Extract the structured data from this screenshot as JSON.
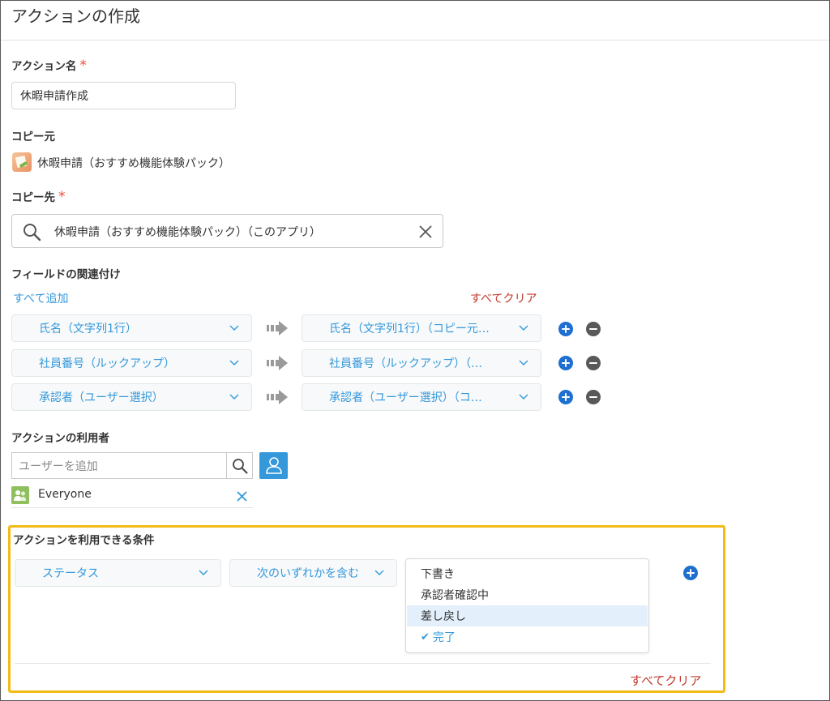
{
  "page": {
    "title": "アクションの作成"
  },
  "action_name": {
    "label": "アクション名",
    "required_mark": "*",
    "value": "休暇申請作成"
  },
  "copy_source": {
    "label": "コピー元",
    "app_name": "休暇申請（おすすめ機能体験パック）"
  },
  "copy_dest": {
    "label": "コピー先",
    "required_mark": "*",
    "value": "休暇申請（おすすめ機能体験パック）（このアプリ）"
  },
  "field_mapping": {
    "label": "フィールドの関連付け",
    "add_all": "すべて追加",
    "clear_all": "すべてクリア",
    "rows": [
      {
        "source": "氏名（文字列1行）",
        "target": "氏名（文字列1行）（コピー元…"
      },
      {
        "source": "社員番号（ルックアップ）",
        "target": "社員番号（ルックアップ）（…"
      },
      {
        "source": "承認者（ユーザー選択）",
        "target": "承認者（ユーザー選択）（コ…"
      }
    ]
  },
  "users": {
    "label": "アクションの利用者",
    "placeholder": "ユーザーを追加",
    "entries": [
      {
        "name": "Everyone"
      }
    ]
  },
  "conditions": {
    "label": "アクションを利用できる条件",
    "field_select": "ステータス",
    "operator_select": "次のいずれかを含む",
    "options": [
      {
        "label": "下書き",
        "selected": false
      },
      {
        "label": "承認者確認中",
        "selected": false
      },
      {
        "label": "差し戻し",
        "selected": false
      },
      {
        "label": "完了",
        "selected": true
      }
    ],
    "check_mark": "✔",
    "clear_all": "すべてクリア"
  },
  "colors": {
    "accent": "#3498db",
    "required": "#e74c3c",
    "danger_link": "#c0392b",
    "highlight": "#f2bb16",
    "plus": "#1e6fd0"
  }
}
